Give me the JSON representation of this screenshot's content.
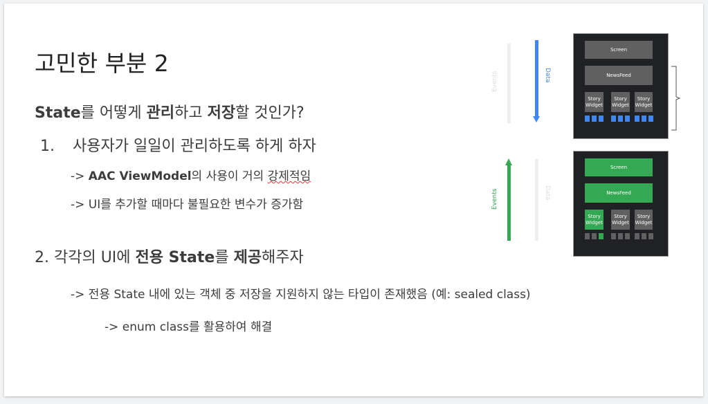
{
  "title": "고민한 부분 2",
  "question": {
    "p1": "State",
    "p2": "를 어떻게 ",
    "p3": "관리",
    "p4": "하고 ",
    "p5": "저장",
    "p6": "할 것인가?"
  },
  "item1": {
    "number": "1.",
    "text": "사용자가 일일이 관리하도록 하게 하자",
    "sub1": {
      "arrow": "-> ",
      "bold": "AAC ViewModel",
      "rest": "의 사용이 거의 ",
      "underlined": "강제적임"
    },
    "sub2": "-> UI를 추가할 때마다 불필요한 변수가 증가함"
  },
  "item2": {
    "p1": "2. 각각의 UI에 ",
    "p2": "전용 State",
    "p3": "를 ",
    "p4": "제공",
    "p5": "해주자",
    "sub1": "-> 전용 State 내에 있는 객체 중 저장을 지원하지 않는 타입이 존재했음 (예: sealed class)",
    "sub2": "-> enum class를 활용하여 해결"
  },
  "diagram": {
    "events_label": "Events",
    "data_label": "Data",
    "screen": "Screen",
    "newsfeed": "NewsFeed",
    "story_widget": "Story Widget",
    "colors": {
      "data": "#4285f4",
      "events": "#34a853",
      "inactive": "#eeeeee",
      "panel": "#202124",
      "block": "#606060"
    }
  }
}
